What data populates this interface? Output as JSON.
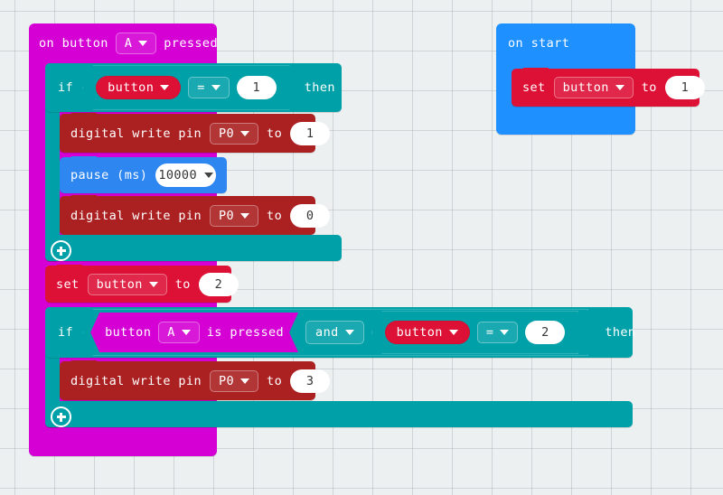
{
  "workspace": {
    "background_color": "#ecf0f1",
    "grid": "dot-cross-grid"
  },
  "palette": {
    "event": "#d400d4",
    "logic": "#00a0a8",
    "variables": "#dd1136",
    "pins": "#ab2021",
    "basic": "#2e86f0",
    "start": "#1e90ff",
    "field_text": "#ffffff",
    "number_field_bg": "#ffffff"
  },
  "scripts": {
    "on_button_pressed": {
      "header": {
        "prefix": "on button",
        "button": "A",
        "suffix": "pressed"
      },
      "if_block_1": {
        "if_label": "if",
        "then_label": "then",
        "condition": {
          "left_variable": "button",
          "operator": "=",
          "right_value": "1"
        },
        "body": [
          {
            "type": "digital-write",
            "label": "digital write pin",
            "pin": "P0",
            "to_label": "to",
            "value": "1"
          },
          {
            "type": "pause",
            "label": "pause (ms)",
            "value": "10000"
          },
          {
            "type": "digital-write",
            "label": "digital write pin",
            "pin": "P0",
            "to_label": "to",
            "value": "0"
          }
        ]
      },
      "set_variable": {
        "set_label": "set",
        "variable": "button",
        "to_label": "to",
        "value": "2"
      },
      "if_block_2": {
        "if_label": "if",
        "then_label": "then",
        "condition": {
          "left": {
            "type": "button-is-pressed",
            "prefix": "button",
            "button": "A",
            "suffix": "is pressed"
          },
          "operator": "and",
          "right": {
            "type": "comparison",
            "left_variable": "button",
            "operator": "=",
            "right_value": "2"
          }
        },
        "body": [
          {
            "type": "digital-write",
            "label": "digital write pin",
            "pin": "P0",
            "to_label": "to",
            "value": "3"
          }
        ]
      }
    },
    "on_start": {
      "header": "on start",
      "set_variable": {
        "set_label": "set",
        "variable": "button",
        "to_label": "to",
        "value": "1"
      }
    }
  },
  "icons": {
    "expand_plus": "+",
    "dropdown_caret": "▼"
  }
}
